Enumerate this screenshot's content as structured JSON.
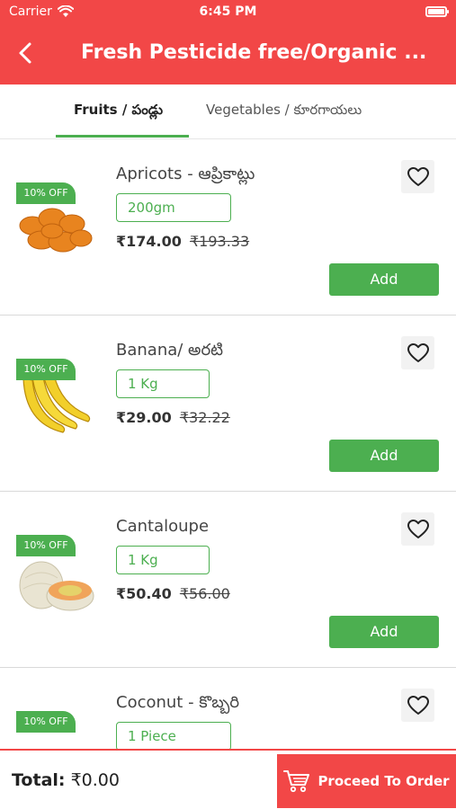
{
  "status_bar": {
    "carrier": "Carrier",
    "time": "6:45 PM"
  },
  "header": {
    "title": "Fresh Pesticide free/Organic ..."
  },
  "tabs": [
    {
      "label": "Fruits / పండ్లు"
    },
    {
      "label": "Vegetables / కూరగాయలు"
    }
  ],
  "products": [
    {
      "name": "Apricots - ఆప్రికాట్లు",
      "badge": "10% OFF",
      "variant": "200gm",
      "price": "₹174.00",
      "mrp": "₹193.33",
      "add_label": "Add"
    },
    {
      "name": "Banana/ అరటి",
      "badge": "10% OFF",
      "variant": "1 Kg",
      "price": "₹29.00",
      "mrp": "₹32.22",
      "add_label": "Add"
    },
    {
      "name": "Cantaloupe",
      "badge": "10% OFF",
      "variant": "1 Kg",
      "price": "₹50.40",
      "mrp": "₹56.00",
      "add_label": "Add"
    },
    {
      "name": "Coconut - కొబ్బరి",
      "badge": "10% OFF",
      "variant": "1 Piece",
      "price": "",
      "mrp": "",
      "add_label": ""
    }
  ],
  "footer": {
    "total_label": "Total:",
    "total_value": "₹0.00",
    "proceed_label": "Proceed To Order"
  },
  "colors": {
    "primary_red": "#f24747",
    "accent_green": "#4caf50"
  }
}
